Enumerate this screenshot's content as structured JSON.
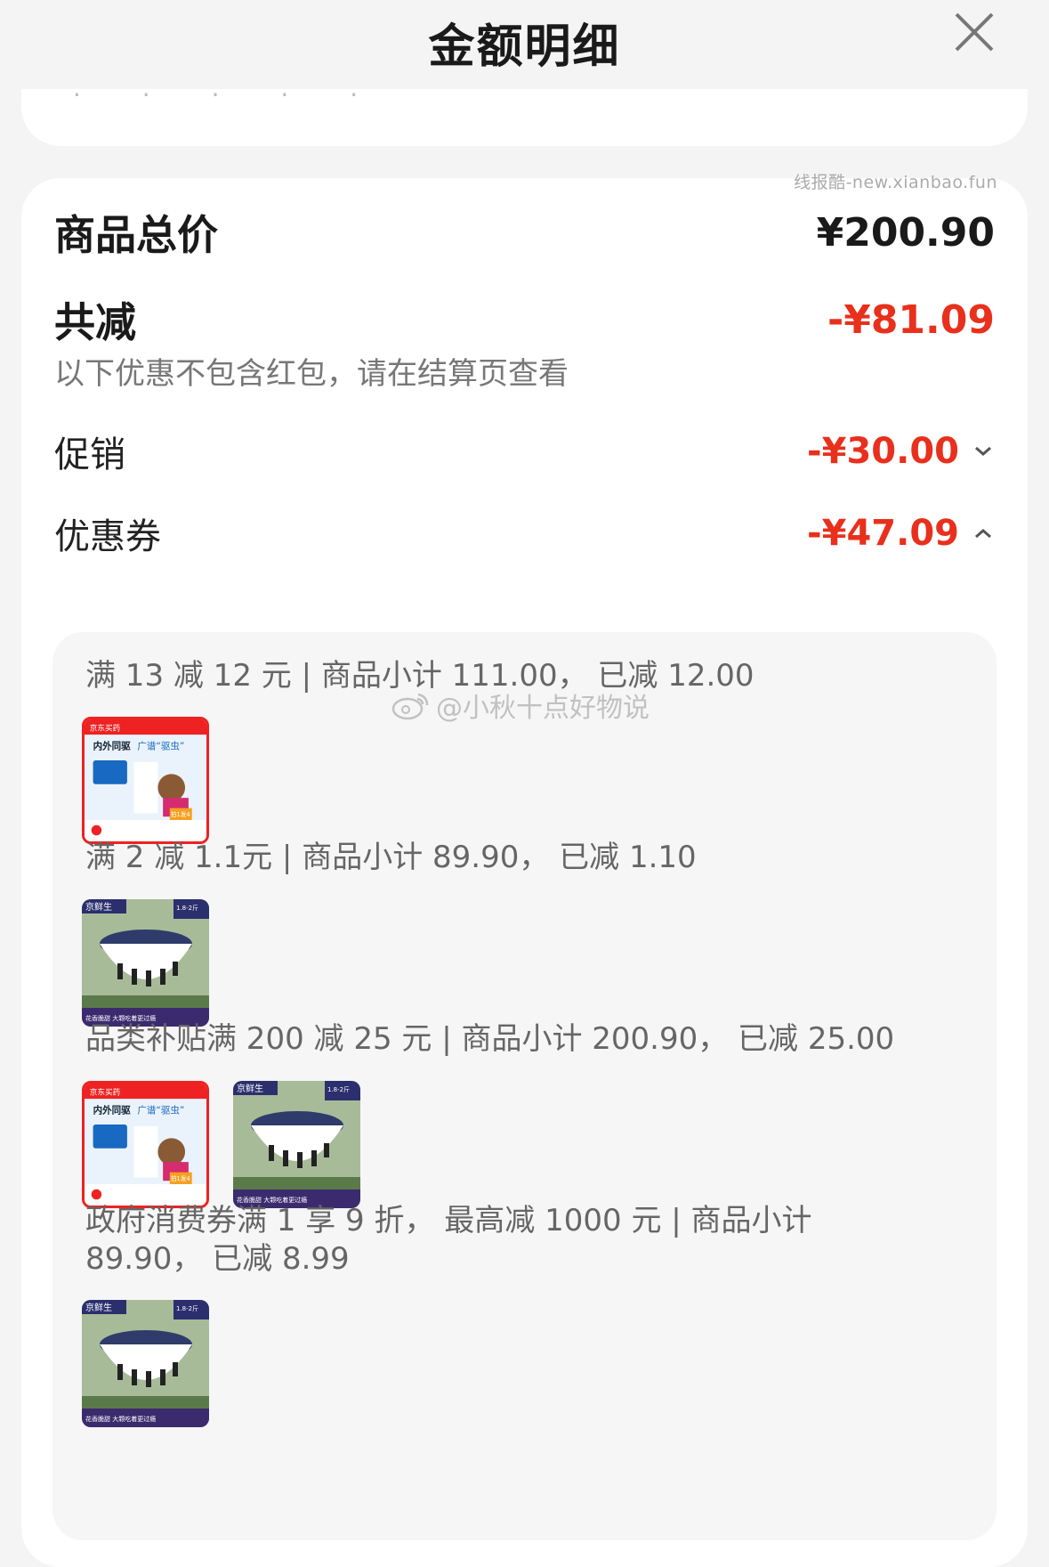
{
  "header": {
    "title": "金额明细"
  },
  "watermark": {
    "url": "线报酷-new.xianbao.fun",
    "weibo": "@小秋十点好物说"
  },
  "summary": {
    "total_label": "商品总价",
    "total_value": "¥200.90",
    "reduce_label": "共减",
    "reduce_value": "-¥81.09",
    "note": "以下优惠不包含红包，请在结算页查看"
  },
  "items": [
    {
      "label": "促销",
      "value": "-¥30.00",
      "expanded": false
    },
    {
      "label": "优惠券",
      "value": "-¥47.09",
      "expanded": true
    }
  ],
  "coupons": [
    {
      "desc": "满 13 减 12 元 | 商品小计 111.00， 已减 12.00",
      "products": [
        "pet-medicine"
      ]
    },
    {
      "desc": "满 2 减 1.1元 | 商品小计 89.90， 已减 1.10",
      "products": [
        "blueberry"
      ]
    },
    {
      "desc": "品类补贴满 200 减 25 元 | 商品小计 200.90， 已减 25.00",
      "products": [
        "pet-medicine",
        "blueberry"
      ]
    },
    {
      "desc": "政府消费券满 1 享 9 折， 最高减 1000 元 | 商品小计 89.90， 已减 8.99",
      "products": [
        "blueberry"
      ]
    }
  ],
  "product_thumbs": {
    "pet": {
      "brand": "京东买药",
      "line1": "内外同驱",
      "line2": "广谱“驱虫”",
      "badge": "拍1发4"
    },
    "berry": {
      "brand": "京鲜生",
      "spec": "1.8-2斤",
      "bottom": "花香脆甜 大颗吃着更过瘾"
    }
  },
  "colors": {
    "accent_red": "#e8301c",
    "card": "#ffffff",
    "panel": "#f6f6f6"
  }
}
